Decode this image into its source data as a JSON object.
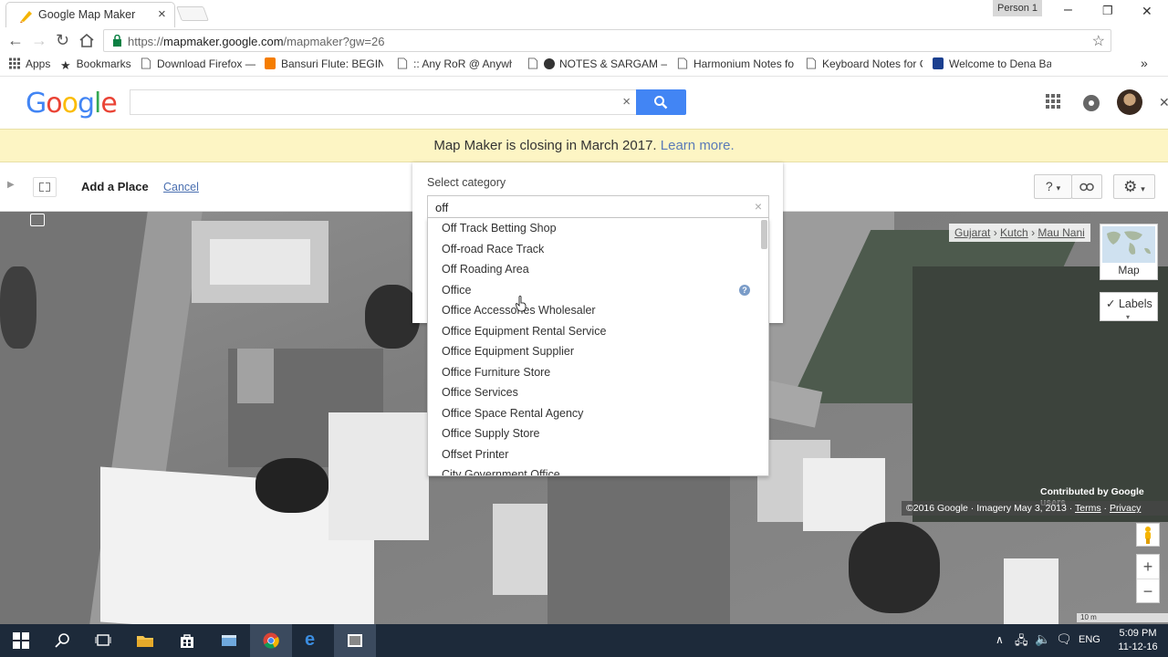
{
  "browser": {
    "tab_title": "Google Map Maker",
    "tab_close": "×",
    "profile": "Person 1",
    "url_prefix": "https://",
    "url_host": "mapmaker.google.com",
    "url_path": "/mapmaker?gw=26",
    "window_min": "–",
    "window_max": "❐",
    "window_close": "✕"
  },
  "bookmarks": [
    {
      "label": "Apps",
      "icon": "apps-grid-icon"
    },
    {
      "label": "Bookmarks",
      "icon": "star-icon"
    },
    {
      "label": "Download Firefox — F",
      "icon": "page-icon"
    },
    {
      "label": "Bansuri Flute: BEGINN",
      "icon": "blogger-icon"
    },
    {
      "label": ":: Any RoR @ Anywhe",
      "icon": "page-icon"
    },
    {
      "label": "NOTES & SARGAM –",
      "icon": "page-icon"
    },
    {
      "label": "Harmonium Notes fo",
      "icon": "page-icon"
    },
    {
      "label": "Keyboard Notes for C",
      "icon": "page-icon"
    },
    {
      "label": "Welcome to Dena Ba",
      "icon": "bank-icon"
    }
  ],
  "bookmarks_more": "»",
  "google": {
    "logo": "Google",
    "search_clear": "×"
  },
  "notice": {
    "text": "Map Maker is closing in March 2017.",
    "link": "Learn more."
  },
  "toolbar": {
    "title": "Add a Place",
    "cancel": "Cancel",
    "help": "?",
    "help_caret": "▾",
    "settings_caret": "▾"
  },
  "category_dialog": {
    "heading": "Select category",
    "input_value": "off",
    "clear": "×",
    "options": [
      "Off Track Betting Shop",
      "Off-road Race Track",
      "Off Roading Area",
      "Office",
      "Office Accessories Wholesaler",
      "Office Equipment Rental Service",
      "Office Equipment Supplier",
      "Office Furniture Store",
      "Office Services",
      "Office Space Rental Agency",
      "Office Supply Store",
      "Offset Printer",
      "City Government Office"
    ],
    "help_badge": "?"
  },
  "map": {
    "breadcrumb": [
      "Gujarat",
      "Kutch",
      "Mau Nani"
    ],
    "breadcrumb_sep": "›",
    "map_type_label": "Map",
    "labels_label": "✓ Labels",
    "labels_caret": "▾",
    "contributed": "Contributed by Google users",
    "copyright": "©2016 Google",
    "imagery": "Imagery May 3, 2013",
    "terms": "Terms",
    "privacy": "Privacy",
    "separator": "·",
    "zoom_in": "+",
    "zoom_out": "−",
    "scale": "10 m"
  },
  "taskbar": {
    "language": "ENG",
    "time": "5:09 PM",
    "date": "11-12-16"
  }
}
